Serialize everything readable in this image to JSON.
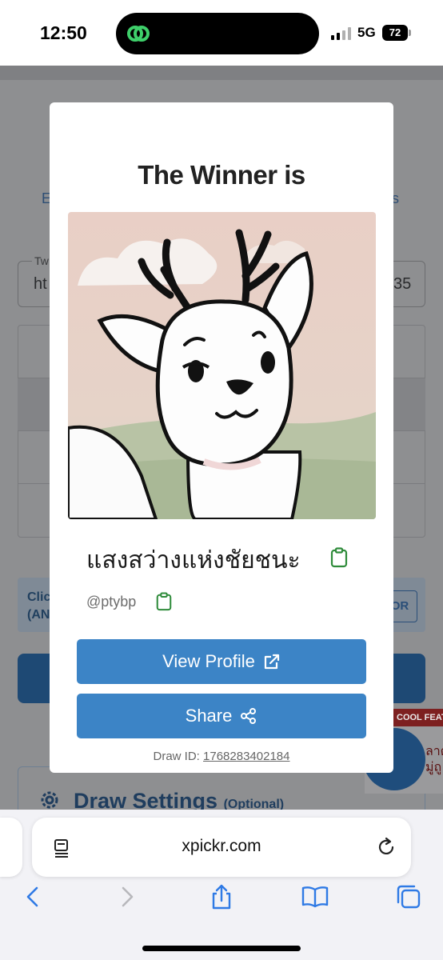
{
  "status_bar": {
    "time": "12:50",
    "network": "5G",
    "battery": "72"
  },
  "background_page": {
    "link_left": "E",
    "link_right": "s",
    "input_label": "Tw",
    "input_value_left": "ht",
    "input_value_right": "35",
    "info_line1": "Clic",
    "info_line2": "(AN",
    "info_button": "OR",
    "settings_title": "Draw Settings",
    "settings_optional": "(Optional)",
    "floating_tag": "COOL FEAT",
    "floating_text_line1": "ลาด",
    "floating_text_line2": "มู่ถู"
  },
  "modal": {
    "title": "The Winner is",
    "winner_name": "แสงสว่างแห่งชัยชนะ",
    "winner_handle": "@ptybp",
    "view_profile_label": "View Profile",
    "share_label": "Share",
    "draw_id_label": "Draw ID:",
    "draw_id_value": "1768283402184"
  },
  "browser": {
    "url": "xpickr.com"
  },
  "colors": {
    "accent": "#3c84c6",
    "copy_icon": "#2e8b3a",
    "island_logo": "#3ecf6a"
  },
  "icons": [
    "app-logo-icon",
    "signal-icon",
    "battery-icon",
    "copy-icon",
    "external-link-icon",
    "share-icon",
    "reader-icon",
    "reload-icon",
    "back-icon",
    "forward-icon",
    "share-sheet-icon",
    "bookmarks-icon",
    "tabs-icon",
    "gear-icon"
  ]
}
